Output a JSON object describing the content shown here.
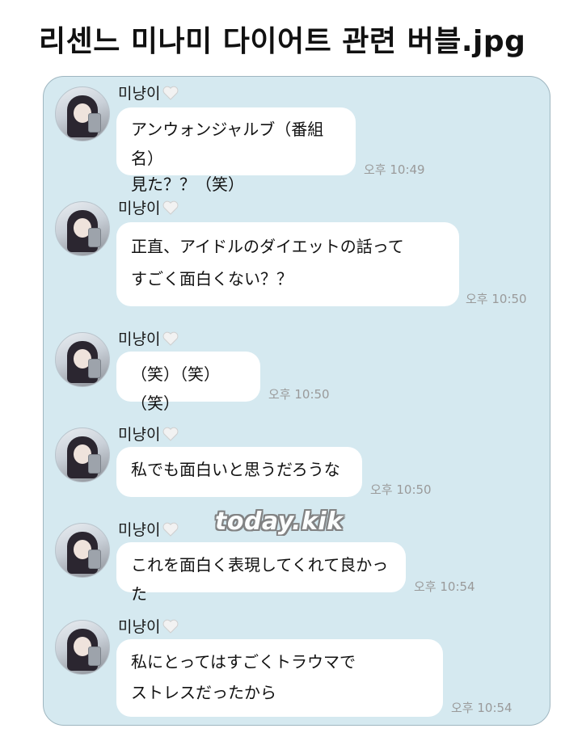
{
  "page": {
    "title": "리센느 미나미 다이어트 관련 버블.jpg"
  },
  "watermark": "today.kik",
  "messages": [
    {
      "sender": "미냥이",
      "lines": [
        "アンウォンジャルブ（番組名）",
        "見た？？（笑）"
      ],
      "time": "오후 10:49"
    },
    {
      "sender": "미냥이",
      "lines": [
        "正直、アイドルのダイエットの話って",
        "すごく面白くない？？"
      ],
      "time": "오후 10:50"
    },
    {
      "sender": "미냥이",
      "lines": [
        "（笑）（笑）（笑）"
      ],
      "time": "오후 10:50"
    },
    {
      "sender": "미냥이",
      "lines": [
        "私でも面白いと思うだろうな"
      ],
      "time": "오후 10:50"
    },
    {
      "sender": "미냥이",
      "lines": [
        "これを面白く表現してくれて良かった"
      ],
      "time": "오후 10:54"
    },
    {
      "sender": "미냥이",
      "lines": [
        "私にとってはすごくトラウマで",
        "ストレスだったから"
      ],
      "time": "오후 10:54"
    }
  ],
  "icons": {
    "heart": "white-heart-icon"
  }
}
